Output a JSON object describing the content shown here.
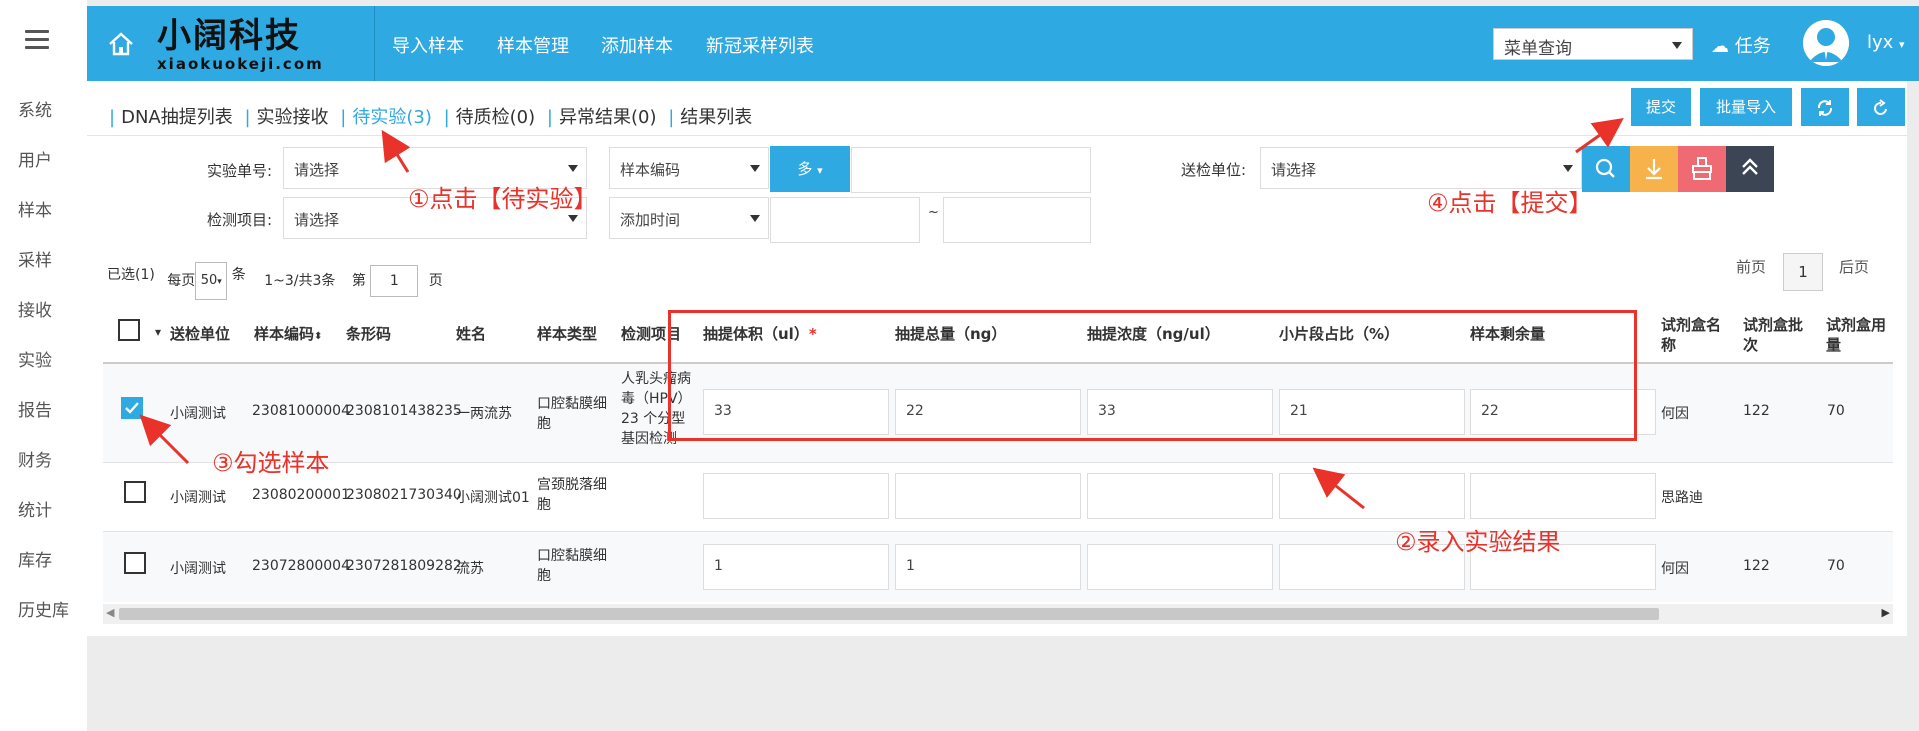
{
  "sidebar": {
    "items": [
      "系统",
      "用户",
      "样本",
      "采样",
      "接收",
      "实验",
      "报告",
      "财务",
      "统计",
      "库存",
      "历史库"
    ]
  },
  "header": {
    "logo_cn": "小阔科技",
    "logo_en": "xiaokuokeji.com",
    "nav": [
      "导入样本",
      "样本管理",
      "添加样本",
      "新冠采样列表"
    ],
    "menu_query": "菜单查询",
    "task": "任务",
    "user": "lyx"
  },
  "subtabs": [
    "DNA抽提列表",
    "实验接收",
    "待实验(3)",
    "待质检(0)",
    "异常结果(0)",
    "结果列表"
  ],
  "toolbar": {
    "submit": "提交",
    "batch_import": "批量导入"
  },
  "filters": {
    "exp_no_label": "实验单号:",
    "exp_no_value": "请选择",
    "sample_code": "样本编码",
    "multi": "多",
    "unit_label": "送检单位:",
    "unit_value": "请选择",
    "item_label": "检测项目:",
    "item_value": "请选择",
    "add_time": "添加时间",
    "tilde": "~"
  },
  "pager": {
    "selected": "已选(1)",
    "per_page_prefix": "每页",
    "per_page": "50",
    "per_page_suffix": "条",
    "range": "1~3/共3条",
    "page_prefix": "第",
    "page_no": "1",
    "page_suffix": "页",
    "prev": "前页",
    "current": "1",
    "next": "后页"
  },
  "table": {
    "headers": [
      "送检单位",
      "样本编码",
      "条形码",
      "姓名",
      "样本类型",
      "检测项目",
      "抽提体积（ul）",
      "抽提总量（ng）",
      "抽提浓度（ng/ul）",
      "小片段占比（%）",
      "样本剩余量",
      "试剂盒名称",
      "试剂盒批次",
      "试剂盒用量"
    ],
    "required_mark": "*",
    "rows": [
      {
        "unit": "小阔测试",
        "code": "23081000004",
        "barcode": "2308101438235",
        "name": "一两流苏",
        "type": "口腔黏膜细胞",
        "item": "人乳头瘤病毒（HPV）23 个分型基因检测",
        "vol": "33",
        "total": "22",
        "conc": "33",
        "ratio": "21",
        "remain": "22",
        "kit": "何因",
        "batch": "122",
        "usage": "70"
      },
      {
        "unit": "小阔测试",
        "code": "23080200001",
        "barcode": "2308021730340",
        "name": "小阔测试01",
        "type": "宫颈脱落细胞",
        "item": "",
        "vol": "",
        "total": "",
        "conc": "",
        "ratio": "",
        "remain": "",
        "kit": "思路迪",
        "batch": "",
        "usage": ""
      },
      {
        "unit": "小阔测试",
        "code": "23072800004",
        "barcode": "2307281809282",
        "name": "流苏",
        "type": "口腔黏膜细胞",
        "item": "",
        "vol": "1",
        "total": "1",
        "conc": "",
        "ratio": "",
        "remain": "",
        "kit": "何因",
        "batch": "122",
        "usage": "70"
      }
    ]
  },
  "annotations": {
    "a1": "①点击【待实验】",
    "a2": "②录入实验结果",
    "a3": "③勾选样本",
    "a4": "④点击【提交】"
  },
  "colors": {
    "primary": "#2fa9e1",
    "annotation": "#e8322a",
    "orange": "#f7b24b",
    "pink": "#f06a74",
    "dark": "#3b4553"
  }
}
